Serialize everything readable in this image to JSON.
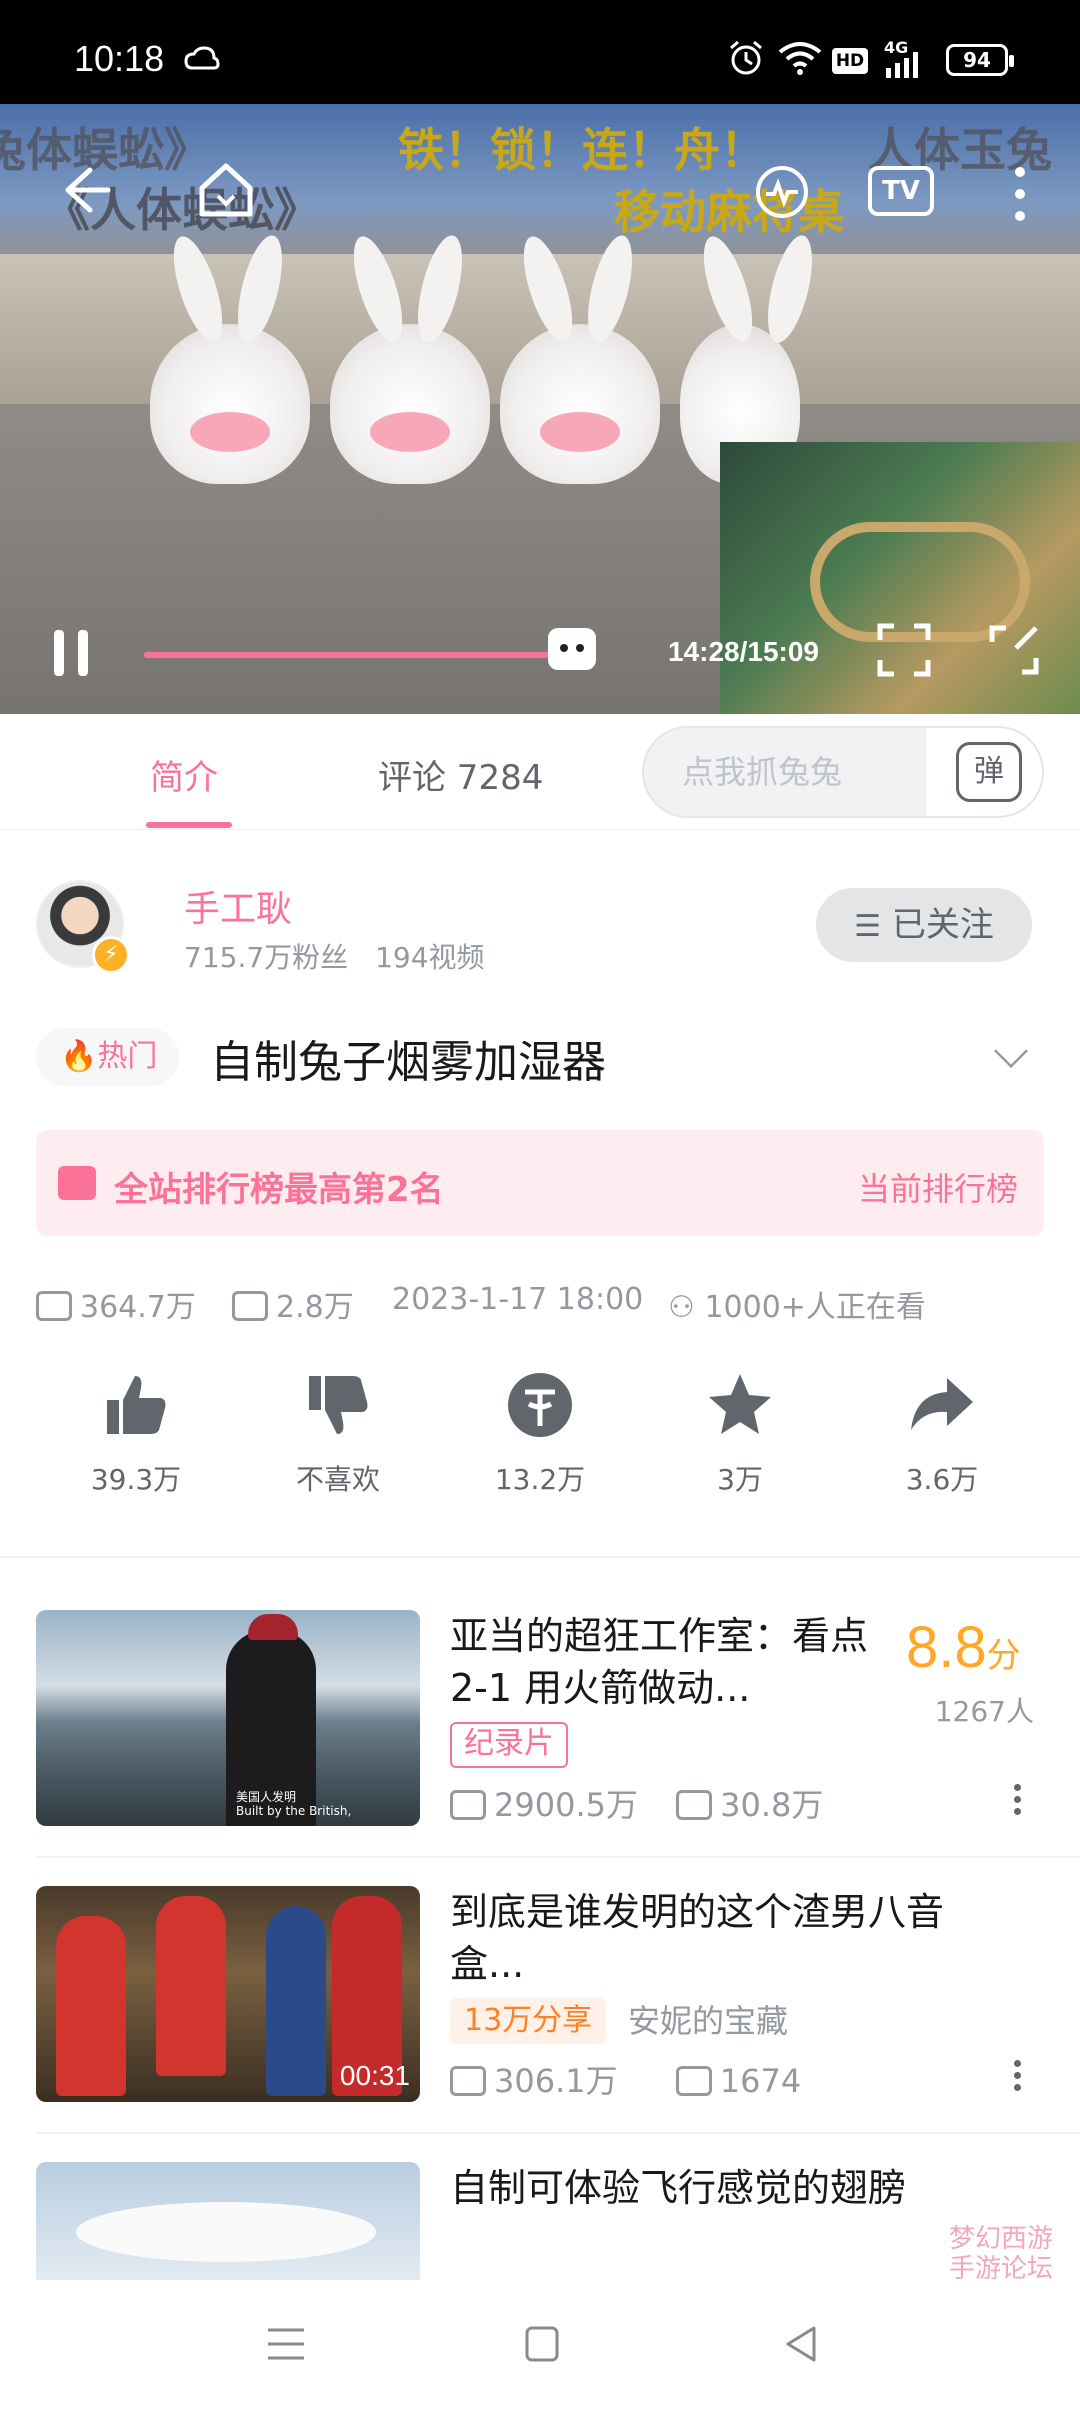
{
  "status_bar": {
    "time": "10:18",
    "battery": "94",
    "network": "4G",
    "hd": "HD"
  },
  "player": {
    "danmaku": [
      "兔体蜈蚣》",
      "《人体蜈蚣》",
      "铁！锁！连！舟！",
      "移动麻将桌",
      "人体玉兔"
    ],
    "cast_label": "TV",
    "time_display": "14:28/15:09",
    "progress": 0.95
  },
  "tabs": {
    "intro": "简介",
    "comments": "评论 7284"
  },
  "danmaku_input": {
    "placeholder": "点我抓兔兔",
    "toggle": "弹"
  },
  "uploader": {
    "name": "手工耿",
    "fans": "715.7万粉丝",
    "videos": "194视频",
    "follow_label": "已关注"
  },
  "video": {
    "hot_tag": "热门",
    "title": "自制兔子烟雾加湿器"
  },
  "ranking": {
    "text": "全站排行榜最高第2名",
    "link": "当前排行榜"
  },
  "stats": {
    "views": "364.7万",
    "danmaku": "2.8万",
    "date": "2023-1-17 18:00",
    "watching": "1000+人正在看"
  },
  "actions": [
    {
      "label": "39.3万",
      "icon": "thumbs-up-icon"
    },
    {
      "label": "不喜欢",
      "icon": "thumbs-down-icon"
    },
    {
      "label": "13.2万",
      "icon": "coin-icon"
    },
    {
      "label": "3万",
      "icon": "star-icon"
    },
    {
      "label": "3.6万",
      "icon": "share-icon"
    }
  ],
  "recommendations": [
    {
      "title": "亚当的超狂工作室：看点2-1 用火箭做动...",
      "tag": "纪录片",
      "views": "2900.5万",
      "comments": "30.8万",
      "score": "8.8",
      "score_unit": "分",
      "raters": "1267人",
      "subtitle_line1": "美国人发明",
      "subtitle_line2": "Built by the British,"
    },
    {
      "title": "到底是谁发明的这个渣男八音盒...",
      "tag": "13万分享",
      "channel": "安妮的宝藏",
      "views": "306.1万",
      "comments": "1674",
      "duration": "00:31"
    },
    {
      "title": "自制可体验飞行感觉的翅膀"
    }
  ],
  "watermark": {
    "line1": "梦幻西游",
    "line2": "手游论坛"
  }
}
